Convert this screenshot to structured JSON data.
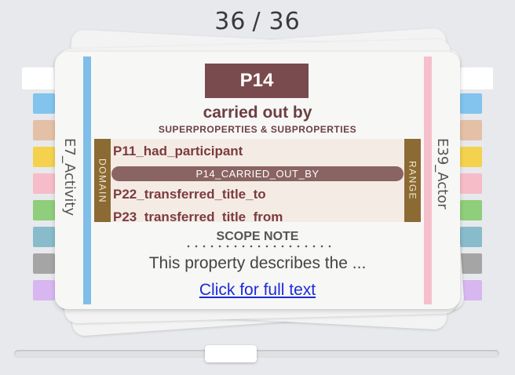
{
  "counter": {
    "current": "36",
    "separator": "/",
    "total": "36"
  },
  "colors": {
    "background": "#e7e9ec",
    "domain_stripe": "#7fbee8",
    "range_stripe": "#f5c0cc",
    "code_badge": "#7a4b4e",
    "side_box": "#8b6a33",
    "link": "#1d2bd6",
    "tab_swatches": [
      "#82c4ee",
      "#e4c0a6",
      "#f4d24e",
      "#f6bcc8",
      "#8fce7a",
      "#88bccb",
      "#a5a5a5",
      "#d8b6f0"
    ]
  },
  "card": {
    "domain_class": "E7_Activity",
    "range_class": "E39_Actor",
    "code": "P14",
    "title": "carried out by",
    "subtitle": "SUPERPROPERTIES & SUBPROPERTIES",
    "domain_label": "DOMAIN",
    "range_label": "RANGE",
    "hierarchy": {
      "above": "P11_had_participant",
      "current": "P14_CARRIED_OUT_BY",
      "below": [
        "P22_transferred_title_to",
        "P23_transferred_title_from"
      ]
    },
    "scope_note_heading": "SCOPE NOTE",
    "scope_note_text": "This property describes the ...",
    "full_text_link": "Click for full text"
  },
  "slider": {
    "position": 0.44
  }
}
